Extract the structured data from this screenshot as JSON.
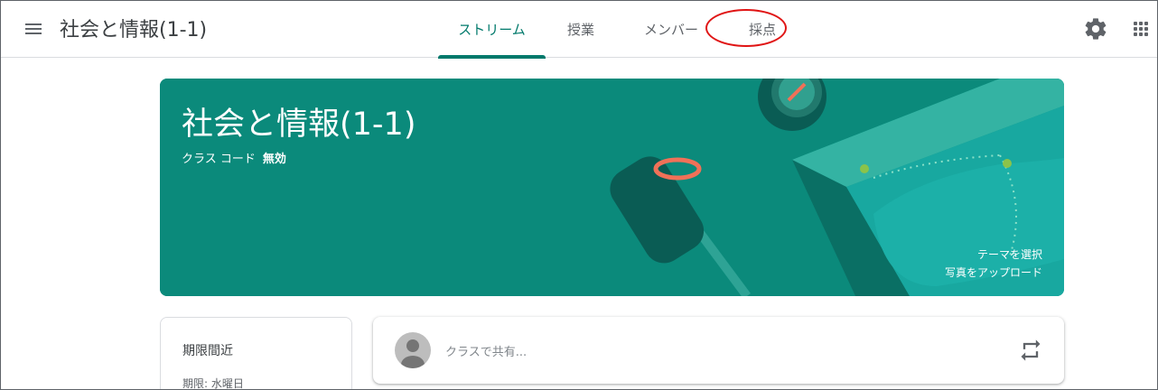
{
  "header": {
    "class_title": "社会と情報(1-1)",
    "tabs": [
      {
        "label": "ストリーム",
        "active": true
      },
      {
        "label": "授業",
        "active": false
      },
      {
        "label": "メンバー",
        "active": false
      },
      {
        "label": "採点",
        "active": false
      }
    ],
    "icons": {
      "menu": "menu-icon",
      "settings": "gear-icon",
      "apps": "apps-grid-icon"
    },
    "annotation_color": "#e01414"
  },
  "banner": {
    "title": "社会と情報(1-1)",
    "class_code_label": "クラス コード",
    "class_code_value": "無効",
    "select_theme": "テーマを選択",
    "upload_photo": "写真をアップロード",
    "color": "#0b8a7b"
  },
  "upcoming": {
    "title": "期限間近",
    "due": "期限: 水曜日"
  },
  "share": {
    "placeholder": "クラスで共有...",
    "icons": {
      "avatar": "avatar-icon",
      "repost": "repost-icon"
    }
  },
  "colors": {
    "accent": "#00796b",
    "text": "#3c4043",
    "muted": "#5f6368"
  }
}
